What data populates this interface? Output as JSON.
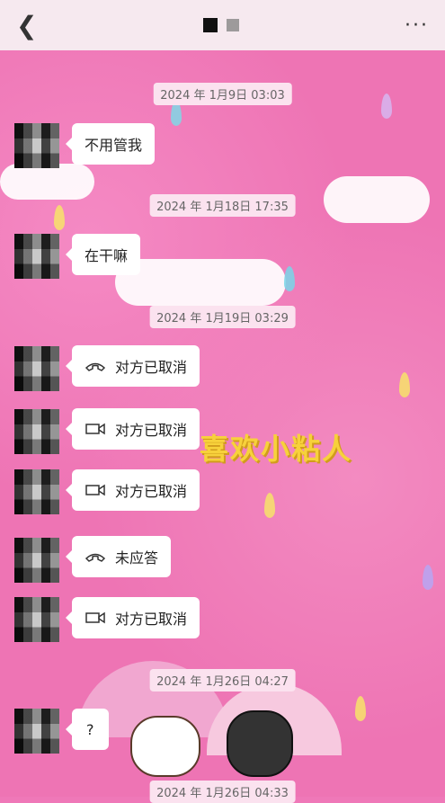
{
  "header": {
    "back_icon": "chevron-left-icon",
    "more_label": "···"
  },
  "timestamps": [
    "2024 年 1月9日 03:03",
    "2024 年 1月18日 17:35",
    "2024 年 1月19日 03:29",
    "2024 年 1月26日 04:27",
    "2024 年 1月26日 04:33"
  ],
  "messages": [
    {
      "text": "不用管我"
    },
    {
      "text": "在干嘛"
    },
    {
      "text": "对方已取消",
      "icon": "phone-icon"
    },
    {
      "text": "对方已取消",
      "icon": "video-icon"
    },
    {
      "text": "对方已取消",
      "icon": "video-icon"
    },
    {
      "text": "未应答",
      "icon": "phone-icon"
    },
    {
      "text": "对方已取消",
      "icon": "video-icon"
    },
    {
      "text": "?"
    }
  ],
  "sticker_text": "喜欢小粘人",
  "colors": {
    "background": "#ee74b4",
    "header": "#f6e9ef",
    "sticker": "#f7d13b"
  }
}
